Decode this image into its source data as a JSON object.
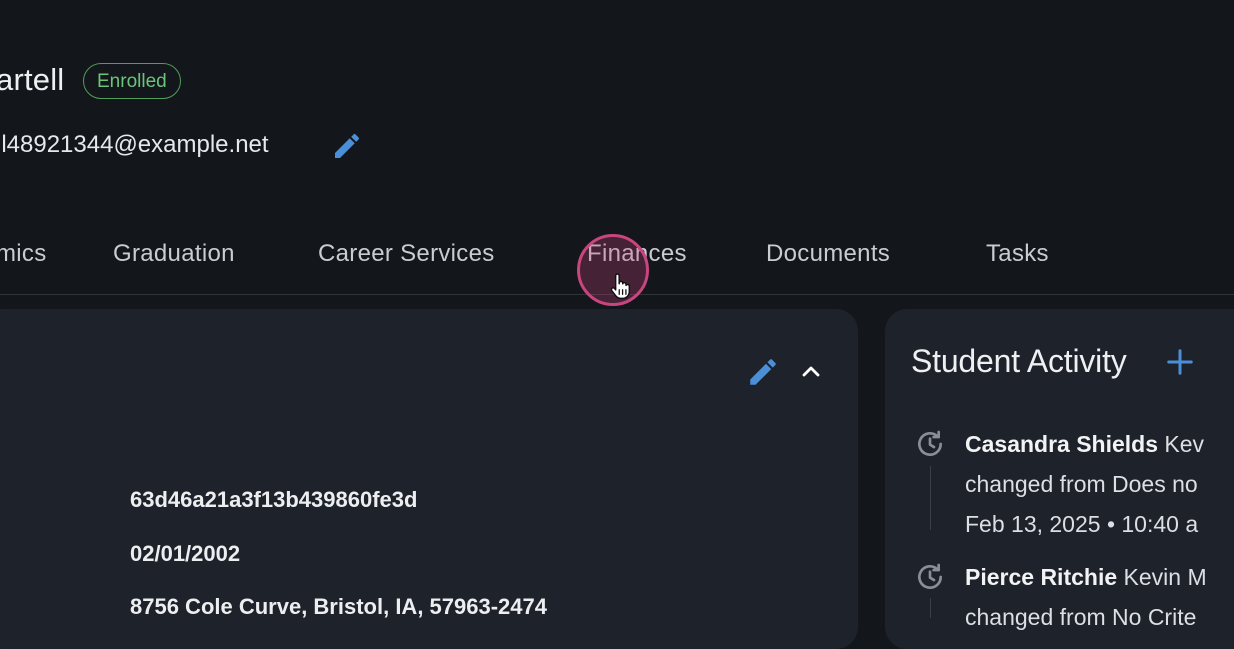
{
  "student": {
    "name_visible": "artell",
    "status": "Enrolled",
    "email_visible": "ll48921344@example.net"
  },
  "tabs": [
    {
      "label": "mics"
    },
    {
      "label": "Graduation"
    },
    {
      "label": "Career Services"
    },
    {
      "label": "Finances"
    },
    {
      "label": "Documents"
    },
    {
      "label": "Tasks"
    }
  ],
  "details": {
    "id_value": "63d46a21a3f13b439860fe3d",
    "dob_value": "02/01/2002",
    "address_value": "8756 Cole Curve, Bristol, IA, 57963-2474"
  },
  "activity": {
    "title": "Student Activity",
    "items": [
      {
        "author": "Casandra Shields",
        "summary_tail": "Kev",
        "line2": "changed from Does no",
        "timestamp": "Feb 13, 2025 • 10:40 a"
      },
      {
        "author": "Pierce Ritchie",
        "summary_tail": "Kevin M",
        "line2": "changed from No Crite"
      }
    ]
  },
  "icons": {
    "edit": "pencil-icon",
    "collapse": "chevron-up-icon",
    "add": "plus-icon",
    "history": "history-icon",
    "cursor": "hand-pointer-icon"
  },
  "colors": {
    "background": "#13161b",
    "card": "#1e222a",
    "accent_blue": "#4a8fd8",
    "enrolled_green": "#6bc47a",
    "cursor_pink": "#c8457f"
  }
}
